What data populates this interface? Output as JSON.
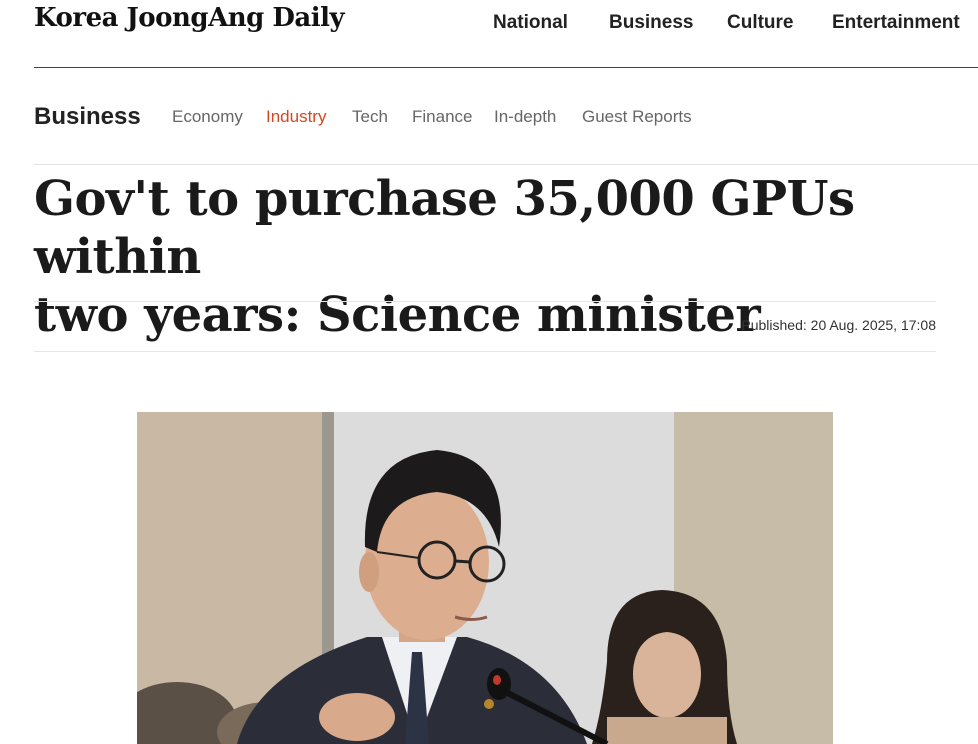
{
  "site": {
    "logo": "Korea JoongAng Daily",
    "topnav": [
      "National",
      "Business",
      "Culture",
      "Entertainment"
    ]
  },
  "section": {
    "title": "Business",
    "subnav": [
      {
        "label": "Economy",
        "active": false
      },
      {
        "label": "Industry",
        "active": true
      },
      {
        "label": "Tech",
        "active": false
      },
      {
        "label": "Finance",
        "active": false
      },
      {
        "label": "In-depth",
        "active": false
      },
      {
        "label": "Guest Reports",
        "active": false
      }
    ],
    "active_color": "#d4471f"
  },
  "article": {
    "headline_line1": "Gov't to purchase 35,000 GPUs within",
    "headline_line2": "two years: Science minister",
    "published": "Published: 20 Aug. 2025, 17:08",
    "photo": "photo of minister speaking into microphone at hearing"
  }
}
